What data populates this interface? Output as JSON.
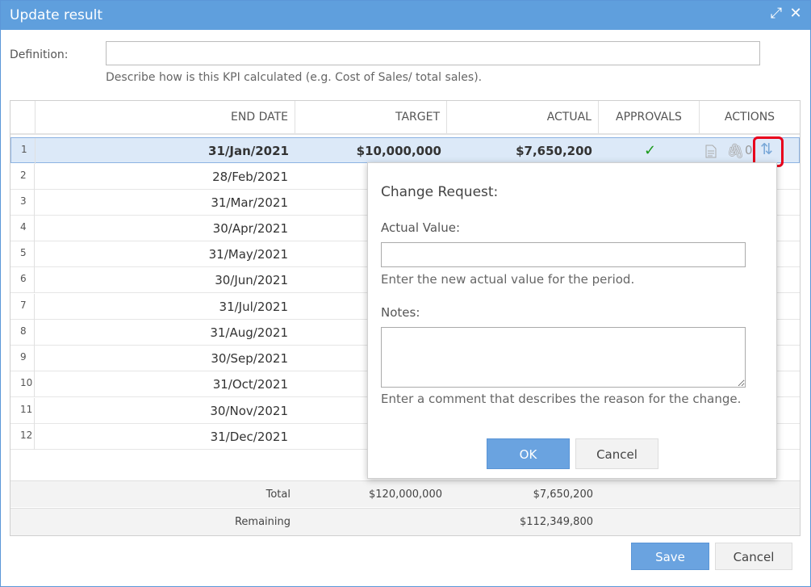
{
  "dialog": {
    "title": "Update result",
    "expand_icon": "expand-icon",
    "close_icon": "close-icon"
  },
  "definition": {
    "label": "Definition:",
    "value": "",
    "help": "Describe how is this KPI calculated (e.g. Cost of Sales/ total sales)."
  },
  "grid": {
    "headers": {
      "end_date": "END DATE",
      "target": "TARGET",
      "actual": "ACTUAL",
      "approvals": "APPROVALS",
      "actions": "ACTIONS"
    },
    "rows": [
      {
        "num": "1",
        "end_date": "31/Jan/2021",
        "target": "$10,000,000",
        "actual": "$7,650,200",
        "approval": "✓",
        "attachments": "0"
      },
      {
        "num": "2",
        "end_date": "28/Feb/2021"
      },
      {
        "num": "3",
        "end_date": "31/Mar/2021"
      },
      {
        "num": "4",
        "end_date": "30/Apr/2021"
      },
      {
        "num": "5",
        "end_date": "31/May/2021"
      },
      {
        "num": "6",
        "end_date": "30/Jun/2021"
      },
      {
        "num": "7",
        "end_date": "31/Jul/2021"
      },
      {
        "num": "8",
        "end_date": "31/Aug/2021"
      },
      {
        "num": "9",
        "end_date": "30/Sep/2021"
      },
      {
        "num": "10",
        "end_date": "31/Oct/2021"
      },
      {
        "num": "11",
        "end_date": "30/Nov/2021"
      },
      {
        "num": "12",
        "end_date": "31/Dec/2021"
      }
    ],
    "total": {
      "label": "Total",
      "target": "$120,000,000",
      "actual": "$7,650,200"
    },
    "remaining": {
      "label": "Remaining",
      "actual": "$112,349,800"
    }
  },
  "change_request": {
    "title": "Change Request:",
    "actual_label": "Actual Value:",
    "actual_value": "",
    "actual_help": "Enter the new actual value for the period.",
    "notes_label": "Notes:",
    "notes_value": "",
    "notes_help": "Enter a comment that describes the reason for the change.",
    "ok_label": "OK",
    "cancel_label": "Cancel"
  },
  "footer": {
    "save_label": "Save",
    "cancel_label": "Cancel"
  },
  "colors": {
    "titlebar": "#5f9fdd",
    "selected_row": "#dce9f8",
    "primary_button": "#6aa3e0",
    "highlight": "#e8001c",
    "approval_check": "#1a9a1a"
  }
}
